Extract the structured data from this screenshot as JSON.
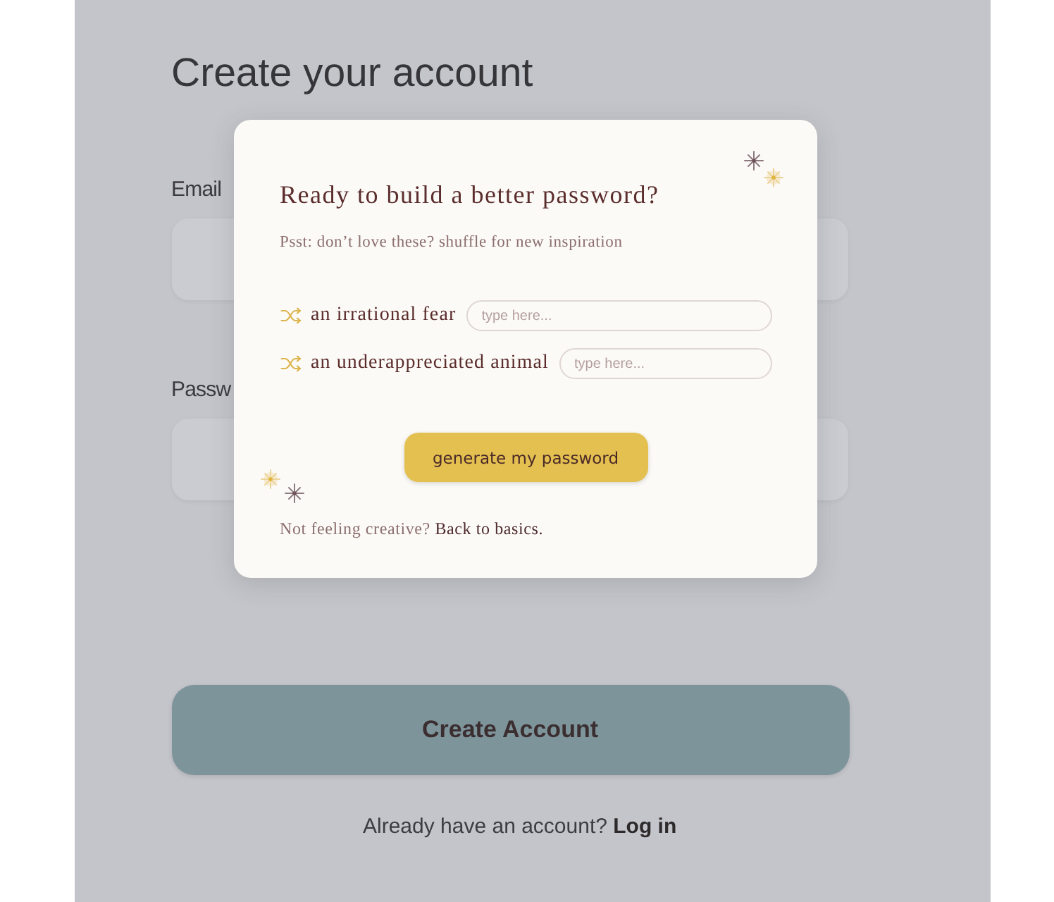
{
  "signup_form": {
    "title": "Create your account",
    "fields": [
      {
        "label": "Email"
      },
      {
        "label": "Passw"
      }
    ],
    "submit_button": "Create Account",
    "footer": {
      "text": "Already have an account?",
      "link": "Log in"
    }
  },
  "password_dialog": {
    "title": "Ready to build a better password?",
    "subtitle": "Psst: don’t love these? shuffle for new inspiration",
    "prompts": [
      {
        "label": "an irrational fear",
        "placeholder": "type here..."
      },
      {
        "label": "an underappreciated animal",
        "placeholder": "type here..."
      }
    ],
    "generate_button": "generate my password",
    "footer": {
      "text": "Not feeling creative?",
      "link": "Back to basics."
    }
  }
}
